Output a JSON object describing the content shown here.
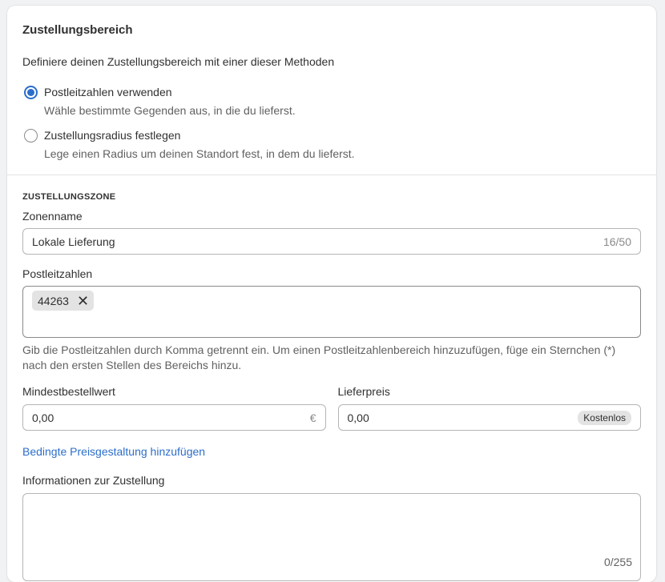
{
  "delivery_area": {
    "title": "Zustellungsbereich",
    "intro": "Definiere deinen Zustellungsbereich mit einer dieser Methoden",
    "options": [
      {
        "label": "Postleitzahlen verwenden",
        "help": "Wähle bestimmte Gegenden aus, in die du lieferst.",
        "checked": true
      },
      {
        "label": "Zustellungsradius festlegen",
        "help": "Lege einen Radius um deinen Standort fest, in dem du lieferst.",
        "checked": false
      }
    ]
  },
  "zone": {
    "heading": "ZUSTELLUNGSZONE",
    "name_label": "Zonenname",
    "name_value": "Lokale Lieferung",
    "name_counter": "16/50",
    "postal_label": "Postleitzahlen",
    "postal_tags": [
      "44263"
    ],
    "postal_tag_remove": "✕",
    "postal_help": "Gib die Postleitzahlen durch Komma getrennt ein. Um einen Postleitzahlenbereich hinzuzufügen, füge ein Sternchen (*) nach den ersten Stellen des Bereichs hinzu.",
    "min_order_label": "Mindestbestellwert",
    "min_order_value": "0,00",
    "min_order_suffix": "€",
    "price_label": "Lieferpreis",
    "price_value": "0,00",
    "price_badge": "Kostenlos",
    "conditional_link": "Bedingte Preisgestaltung hinzufügen",
    "info_label": "Informationen zur Zustellung",
    "info_value": "",
    "info_counter": "0/255"
  },
  "colors": {
    "accent": "#2c6ecb",
    "text": "#303030",
    "subdued": "#616161"
  }
}
